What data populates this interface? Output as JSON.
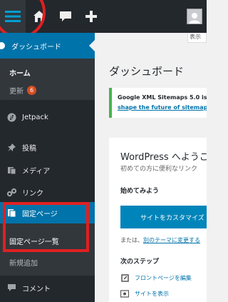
{
  "adminbar": {
    "icons": [
      "menu-icon",
      "home-icon",
      "comment-icon",
      "plus-icon",
      "avatar"
    ]
  },
  "sidebar": {
    "current": "ダッシュボード",
    "home": "ホーム",
    "update": "更新",
    "update_count": "6",
    "jetpack": "Jetpack",
    "posts": "投稿",
    "media": "メディア",
    "links": "リンク",
    "pages": "固定ページ",
    "pages_list": "固定ページ一覧",
    "add_new": "新規追加",
    "comments": "コメント"
  },
  "main": {
    "screen_options": "表示",
    "title": "ダッシュボード",
    "notice_line1": "Google XML Sitemaps 5.0 is",
    "notice_line2": "shape the future of sitemaps",
    "welcome_title": "WordPress へようこ",
    "welcome_sub": "初めての方に便利なリンク",
    "get_started": "始めてみよう",
    "customize_button": "サイトをカスタマイズ",
    "or_prefix": "または、",
    "or_link": "別のテーマに変更する",
    "next_steps": "次のステップ",
    "step_front": "フロントページを編集",
    "step_view": "サイトを表示"
  },
  "colors": {
    "admin_bg": "#23282d",
    "active_blue": "#0073aa",
    "annotation_red": "#e02020"
  }
}
